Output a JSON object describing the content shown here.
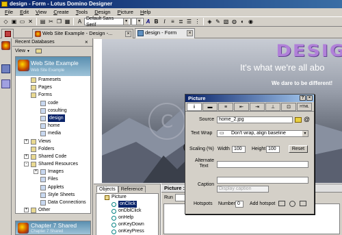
{
  "window": {
    "title": "design - Form - Lotus Domino Designer"
  },
  "menu": {
    "items": [
      {
        "label": "File",
        "key": "F",
        "rest": "ile"
      },
      {
        "label": "Edit",
        "key": "E",
        "rest": "dit"
      },
      {
        "label": "View",
        "key": "V",
        "rest": "iew"
      },
      {
        "label": "Create",
        "key": "C",
        "rest": "reate"
      },
      {
        "label": "Tools",
        "key": "T",
        "rest": "ools"
      },
      {
        "label": "Design",
        "key": "D",
        "rest": "esign"
      },
      {
        "label": "Picture",
        "key": "P",
        "rest": "icture"
      },
      {
        "label": "Help",
        "key": "H",
        "rest": "elp"
      }
    ]
  },
  "toolbar": {
    "font_combo": "Default Sans Serif"
  },
  "tabs": [
    {
      "label": "Web Site Example - Design -..."
    },
    {
      "label": "design - Form"
    }
  ],
  "nav": {
    "heading": "Recent Databases",
    "view_label": "View",
    "db1": {
      "title": "Web Site Example",
      "subtitle": "Web Site Example"
    },
    "tree": [
      {
        "label": "Framesets",
        "level": 1
      },
      {
        "label": "Pages",
        "level": 1
      },
      {
        "label": "Forms",
        "level": 1
      },
      {
        "label": "code",
        "level": 2
      },
      {
        "label": "cosulting",
        "level": 2
      },
      {
        "label": "design",
        "level": 2,
        "selected": true
      },
      {
        "label": "home",
        "level": 2
      },
      {
        "label": "media",
        "level": 2
      },
      {
        "label": "Views",
        "level": 1,
        "expander": "+"
      },
      {
        "label": "Folders",
        "level": 1
      },
      {
        "label": "Shared Code",
        "level": 1,
        "expander": "+"
      },
      {
        "label": "Shared Resources",
        "level": 1,
        "expander": "-"
      },
      {
        "label": "Images",
        "level": 2,
        "expander": "+"
      },
      {
        "label": "Files",
        "level": 2
      },
      {
        "label": "Applets",
        "level": 2
      },
      {
        "label": "Style Sheets",
        "level": 2
      },
      {
        "label": "Data Connections",
        "level": 2
      },
      {
        "label": "Other",
        "level": 1,
        "expander": "+"
      }
    ],
    "db2": {
      "title": "Chapter 7 Shared",
      "subtitle": "Chapter 7 Shared"
    }
  },
  "banner": {
    "logo": "DESIG",
    "tagline": "It's what we're all abo",
    "intro": "We dare to be different!"
  },
  "objects": {
    "tabs": [
      "Objects",
      "Reference"
    ],
    "items": [
      {
        "label": "Picture",
        "level": 1
      },
      {
        "label": "onClick",
        "level": 2,
        "selected": true
      },
      {
        "label": "onDblClick",
        "level": 2
      },
      {
        "label": "onHelp",
        "level": 2
      },
      {
        "label": "onKeyDown",
        "level": 2
      },
      {
        "label": "onKeyPress",
        "level": 2
      }
    ]
  },
  "code": {
    "heading": "Picture :",
    "run_label": "Run"
  },
  "props": {
    "title": "Picture",
    "source_label": "Source",
    "source_value": "home_2.jpg",
    "textwrap_label": "Text Wrap",
    "textwrap_value": "Don't wrap, align baseline",
    "scaling_label": "Scaling (%)",
    "width_label": "Width",
    "width_value": "100",
    "height_label": "Height",
    "height_value": "100",
    "reset_label": "Reset",
    "alttext_label": "Alternate Text",
    "caption_label": "Caption",
    "caption_placeholder": "Display caption",
    "hotspots_label": "Hotspots",
    "number_label": "Number",
    "number_value": "0",
    "addhotspot_label": "Add hotspot",
    "tab_html": "HTML"
  },
  "colors": {
    "titlebar": "#0a246a",
    "selection": "#0a246a",
    "logo": "#b080d8",
    "db_header": "#5a8fb0"
  }
}
